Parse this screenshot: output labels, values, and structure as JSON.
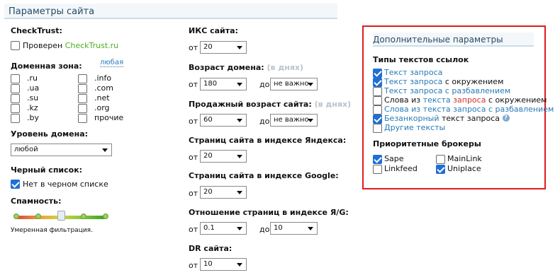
{
  "header": {
    "title": "Параметры сайта"
  },
  "checktrust": {
    "label": "CheckTrust:",
    "checkbox_text": "Проверен ",
    "checkbox_link": "CheckTrust.ru"
  },
  "domain_zone": {
    "label": "Доменная зона:",
    "any_link": "любая",
    "col1": [
      ".ru",
      ".ua",
      ".su",
      ".kz",
      ".by"
    ],
    "col2": [
      ".info",
      ".com",
      ".net",
      ".org",
      "прочие"
    ]
  },
  "domain_level": {
    "label": "Уровень домена:",
    "value": "любой"
  },
  "blacklist": {
    "label": "Черный список:",
    "checkbox_text": "Нет в черном списке"
  },
  "spam": {
    "label": "Спамность:",
    "caption": "Умеренная фильтрация.",
    "level_percent": 50
  },
  "iks": {
    "label": "ИКС сайта:",
    "from_label": "от",
    "from_value": "20"
  },
  "domain_age": {
    "label": "Возраст домена:",
    "hint": "(в днях)",
    "from_label": "от",
    "from_value": "180",
    "to_label": "до",
    "to_value": "не важно"
  },
  "sale_age": {
    "label": "Продажный возраст сайта:",
    "hint": "(в днях)",
    "from_label": "от",
    "from_value": "60",
    "to_label": "до",
    "to_value": "не важно"
  },
  "yandex_pages": {
    "label": "Страниц сайта в индексе Яндекса:",
    "from_label": "от",
    "from_value": "20"
  },
  "google_pages": {
    "label": "Страниц сайта в индексе Google:",
    "from_label": "от",
    "from_value": "20"
  },
  "ratio": {
    "label": "Отношение страниц в индексе Я/G:",
    "from_label": "от",
    "from_value": "0.1",
    "to_label": "до",
    "to_value": "10"
  },
  "dr": {
    "label": "DR сайта:",
    "from_label": "от",
    "from_value": "10"
  },
  "extra": {
    "title": "Дополнительные параметры",
    "types_label": "Типы текстов ссылок",
    "types": {
      "t1": "Текст запроса",
      "t2a": "Текст запроса",
      "t2b": " с окружением",
      "t3": "Текст запроса с разбавлением",
      "t4a": "Слова из ",
      "t4b": "текста ",
      "t4c": "запроса",
      "t4d": " с окружением",
      "t5": "Слова из текста запроса с разбавлением",
      "t6a": "Безанкорный",
      "t6b": " текст запроса",
      "t7": "Другие тексты"
    },
    "help_symbol": "?",
    "brokers_label": "Приоритетные брокеры",
    "brokers": [
      "Sape",
      "MainLink",
      "Linkfeed",
      "Uniplace"
    ]
  },
  "colors": {
    "accent": "#1f6fd4",
    "link": "#2a7bb8",
    "highlight": "#e01b1b",
    "trust": "#4caf1f"
  }
}
